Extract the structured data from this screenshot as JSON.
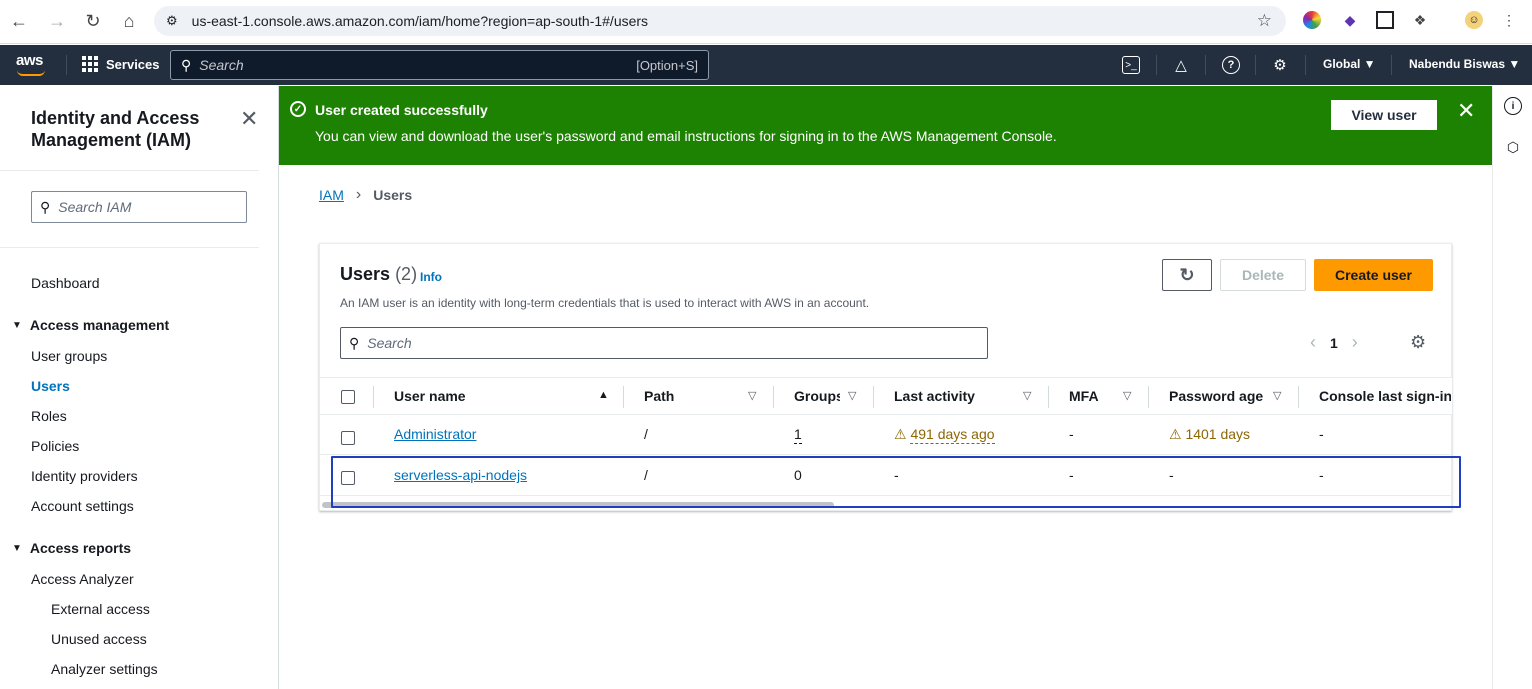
{
  "browser": {
    "url": "us-east-1.console.aws.amazon.com/iam/home?region=ap-south-1#/users"
  },
  "awsbar": {
    "logo": "aws",
    "services_label": "Services",
    "search_placeholder": "Search",
    "search_shortcut": "[Option+S]",
    "region": "Global ▼",
    "account": "Nabendu Biswas ▼"
  },
  "sidebar": {
    "title": "Identity and Access Management (IAM)",
    "search_placeholder": "Search IAM",
    "dashboard": "Dashboard",
    "access_management": "Access management",
    "user_groups": "User groups",
    "users": "Users",
    "roles": "Roles",
    "policies": "Policies",
    "identity_providers": "Identity providers",
    "account_settings": "Account settings",
    "access_reports": "Access reports",
    "access_analyzer": "Access Analyzer",
    "external_access": "External access",
    "unused_access": "Unused access",
    "analyzer_settings": "Analyzer settings"
  },
  "flash": {
    "title": "User created successfully",
    "body": "You can view and download the user's password and email instructions for signing in to the AWS Management Console.",
    "view_user": "View user"
  },
  "breadcrumb": {
    "root": "IAM",
    "current": "Users"
  },
  "users_card": {
    "title": "Users",
    "count": "(2)",
    "info": "Info",
    "description": "An IAM user is an identity with long-term credentials that is used to interact with AWS in an account.",
    "delete_label": "Delete",
    "create_label": "Create user",
    "search_placeholder": "Search",
    "page": "1",
    "columns": {
      "user_name": "User name",
      "path": "Path",
      "groups": "Groups",
      "last_activity": "Last activity",
      "mfa": "MFA",
      "password_age": "Password age",
      "console_last_signin": "Console last sign-in"
    },
    "rows": [
      {
        "user_name": "Administrator",
        "path": "/",
        "groups": "1",
        "last_activity": "491 days ago",
        "mfa": "-",
        "password_age": "1401 days",
        "console_last_signin": "-"
      },
      {
        "user_name": "serverless-api-nodejs",
        "path": "/",
        "groups": "0",
        "last_activity": "-",
        "mfa": "-",
        "password_age": "-",
        "console_last_signin": "-"
      }
    ]
  },
  "colors": {
    "success_green": "#1d8102",
    "aws_nav": "#232f3e",
    "primary_orange": "#ff9900",
    "link_blue": "#0073bb",
    "highlight_box": "#1f3fbf"
  }
}
